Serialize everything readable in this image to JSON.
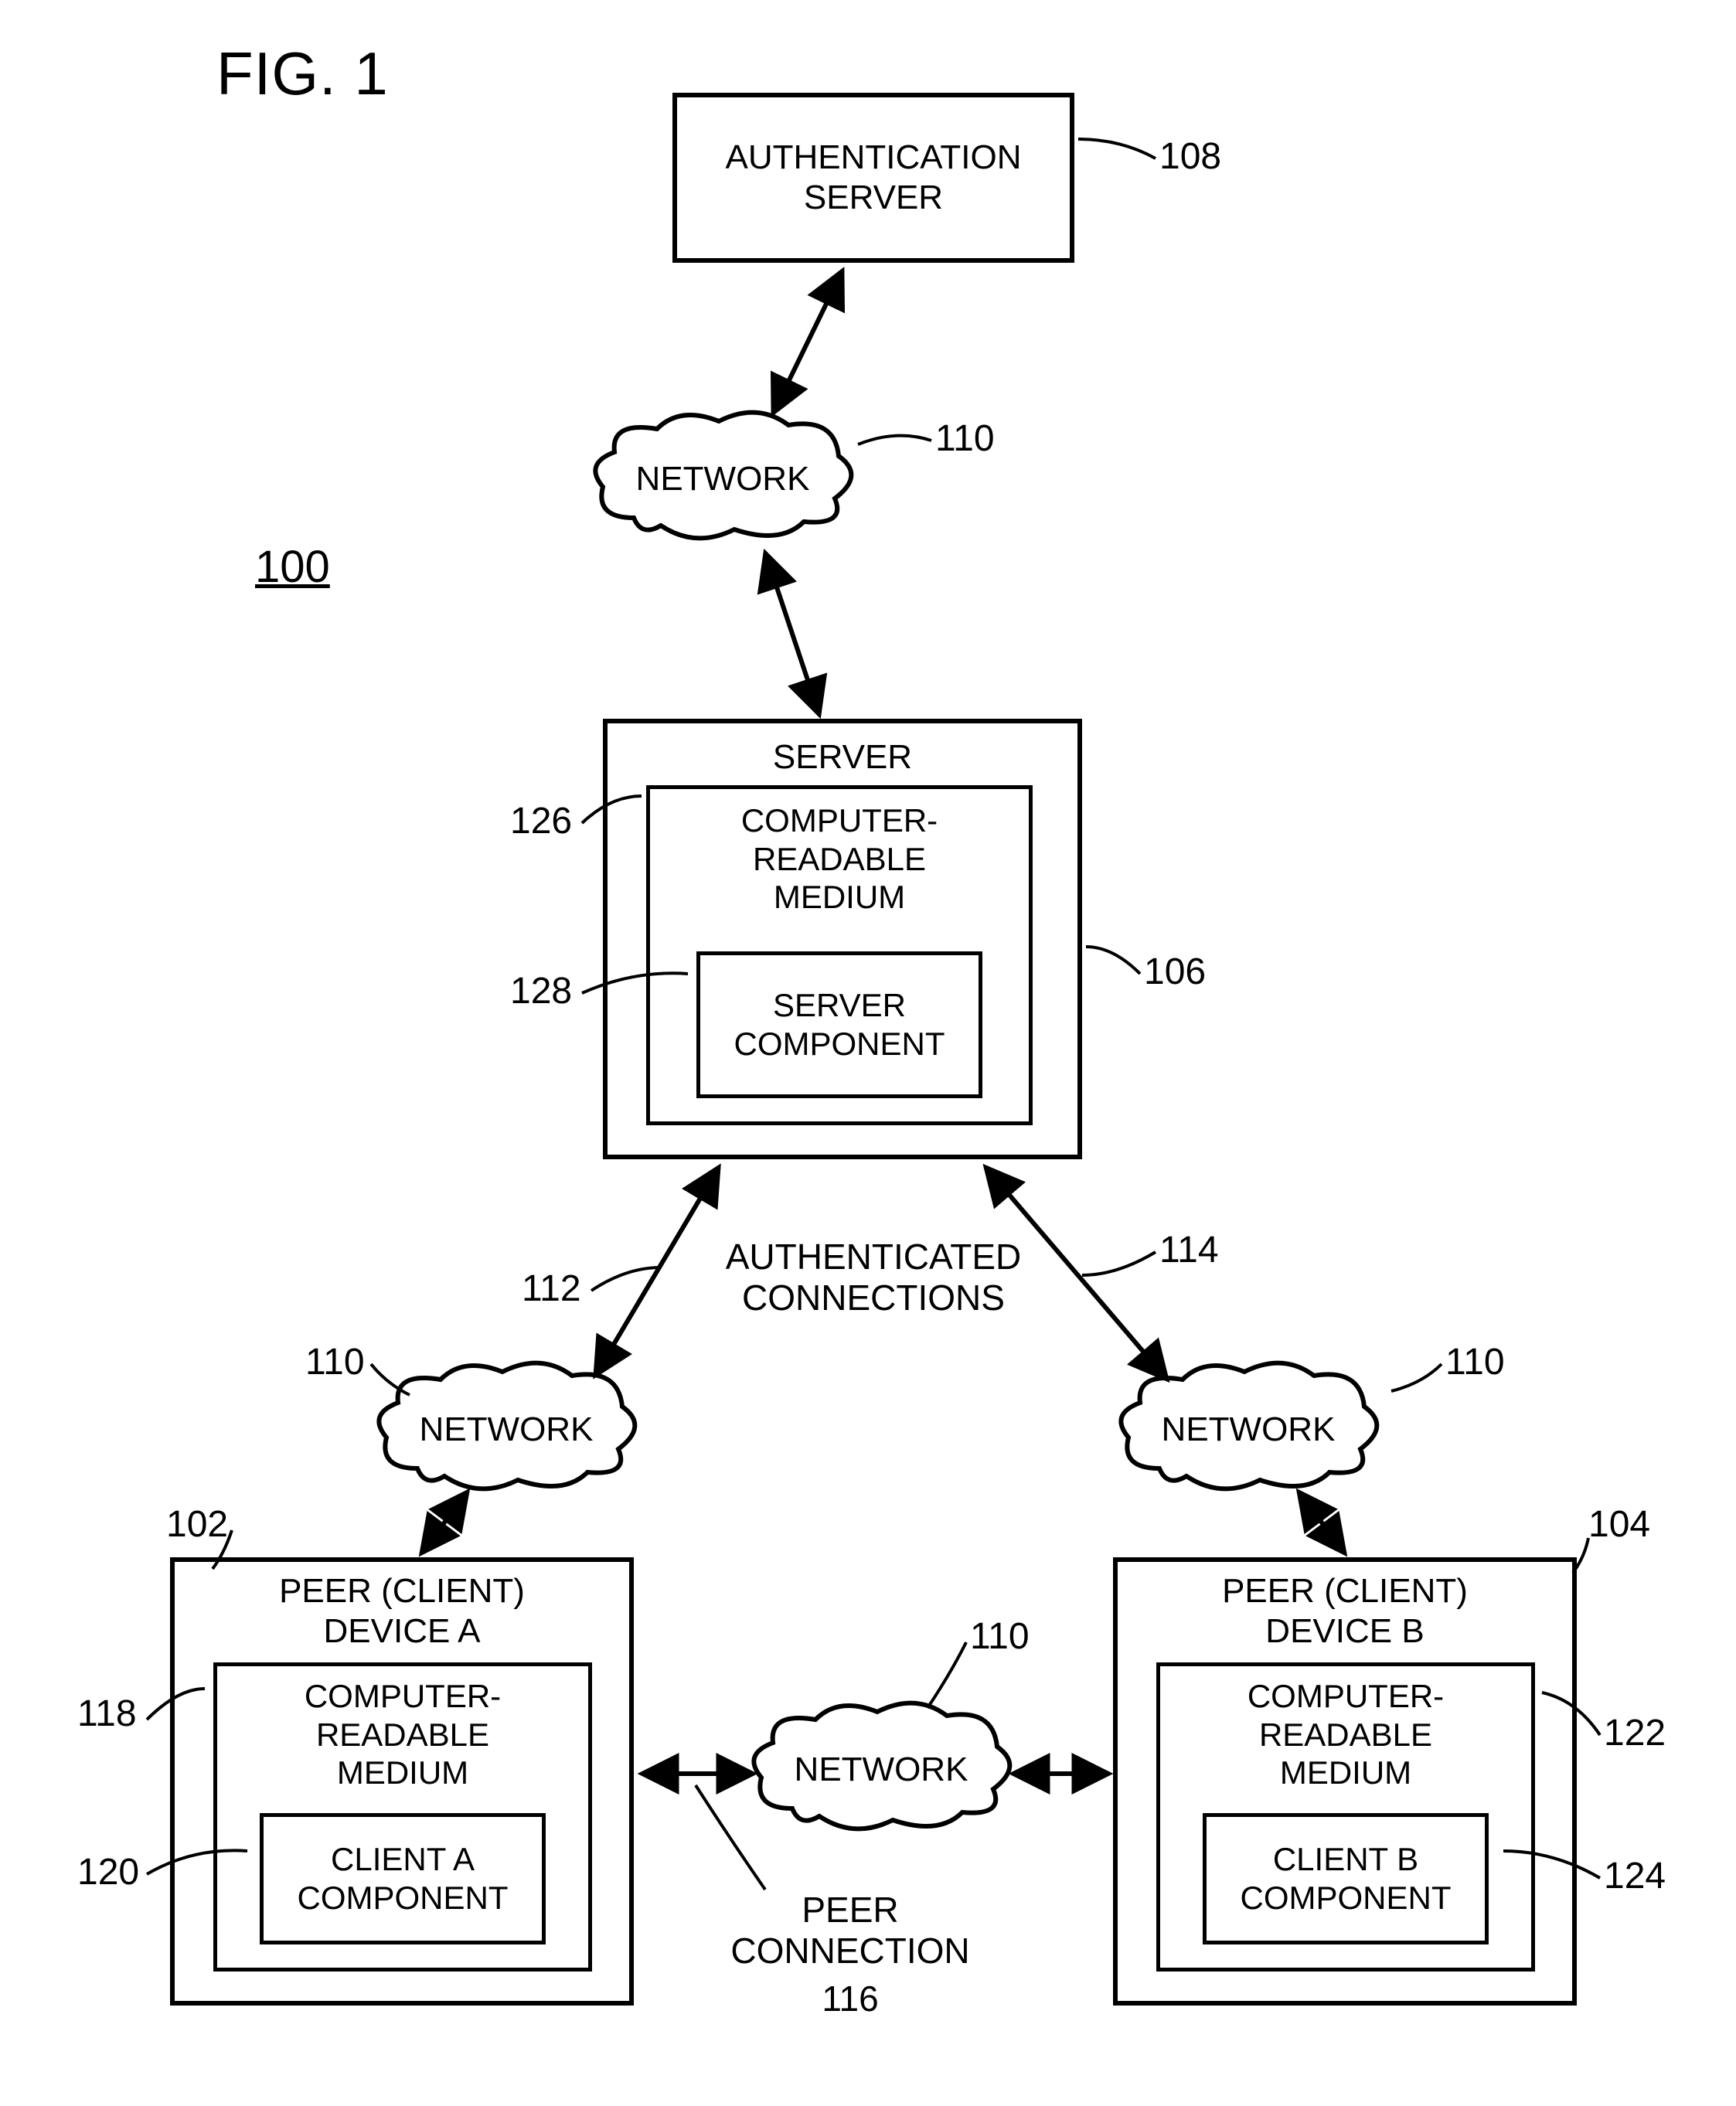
{
  "figure": {
    "title": "FIG. 1",
    "system_ref": "100"
  },
  "boxes": {
    "auth_server": {
      "label": "AUTHENTICATION\nSERVER",
      "ref": "108"
    },
    "server": {
      "label": "SERVER",
      "ref": "106",
      "medium_label": "COMPUTER-\nREADABLE\nMEDIUM",
      "medium_ref": "126",
      "component_label": "SERVER\nCOMPONENT",
      "component_ref": "128"
    },
    "peer_a": {
      "label": "PEER (CLIENT)\nDEVICE A",
      "ref": "102",
      "medium_label": "COMPUTER-\nREADABLE\nMEDIUM",
      "medium_ref": "118",
      "component_label": "CLIENT A\nCOMPONENT",
      "component_ref": "120"
    },
    "peer_b": {
      "label": "PEER (CLIENT)\nDEVICE B",
      "ref": "104",
      "medium_label": "COMPUTER-\nREADABLE\nMEDIUM",
      "medium_ref": "122",
      "component_label": "CLIENT B\nCOMPONENT",
      "component_ref": "124"
    }
  },
  "clouds": {
    "top": {
      "label": "NETWORK",
      "ref": "110"
    },
    "left": {
      "label": "NETWORK",
      "ref": "110"
    },
    "right": {
      "label": "NETWORK",
      "ref": "110"
    },
    "bottom": {
      "label": "NETWORK",
      "ref": "110"
    }
  },
  "connections": {
    "authenticated_label": "AUTHENTICATED\nCONNECTIONS",
    "left_ref": "112",
    "right_ref": "114",
    "peer_label": "PEER\nCONNECTION",
    "peer_ref": "116"
  }
}
